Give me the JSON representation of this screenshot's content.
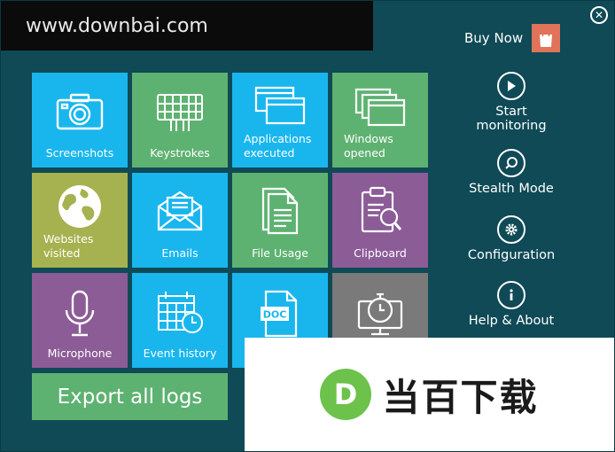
{
  "watermarks": {
    "top_text": "www.downbai.com",
    "bottom_text": "当百下载",
    "bottom_logo_letter": "D"
  },
  "header": {
    "buy_now": "Buy Now",
    "close_glyph": "✕"
  },
  "tiles": [
    {
      "label": "Screenshots",
      "icon": "camera-icon"
    },
    {
      "label": "Keystrokes",
      "icon": "keyboard-icon"
    },
    {
      "label": "Applications executed",
      "icon": "app-windows-icon"
    },
    {
      "label": "Windows opened",
      "icon": "stacked-windows-icon"
    },
    {
      "label": "Websites visited",
      "icon": "globe-icon"
    },
    {
      "label": "Emails",
      "icon": "envelope-icon"
    },
    {
      "label": "File Usage",
      "icon": "document-icon"
    },
    {
      "label": "Clipboard",
      "icon": "clipboard-icon"
    },
    {
      "label": "Microphone",
      "icon": "microphone-icon"
    },
    {
      "label": "Event history",
      "icon": "calendar-clock-icon"
    },
    {
      "label": "",
      "icon": "doc-file-icon",
      "badge": "DOC"
    },
    {
      "label": "",
      "icon": "timer-monitor-icon"
    }
  ],
  "export": {
    "label": "Export all logs"
  },
  "side_menu": [
    {
      "label": "Start monitoring",
      "icon": "play-icon"
    },
    {
      "label": "Stealth Mode",
      "icon": "magnifier-icon"
    },
    {
      "label": "Configuration",
      "icon": "gear-icon"
    },
    {
      "label": "Help & About",
      "icon": "info-icon"
    }
  ],
  "colors": {
    "background": "#0f4a56",
    "tile_blue": "#19b6ee",
    "tile_green": "#5eb271",
    "tile_olive": "#a6b24f",
    "tile_purple": "#8c5c97",
    "tile_gray": "#7a7a7a",
    "buy_bag": "#e0735a"
  }
}
